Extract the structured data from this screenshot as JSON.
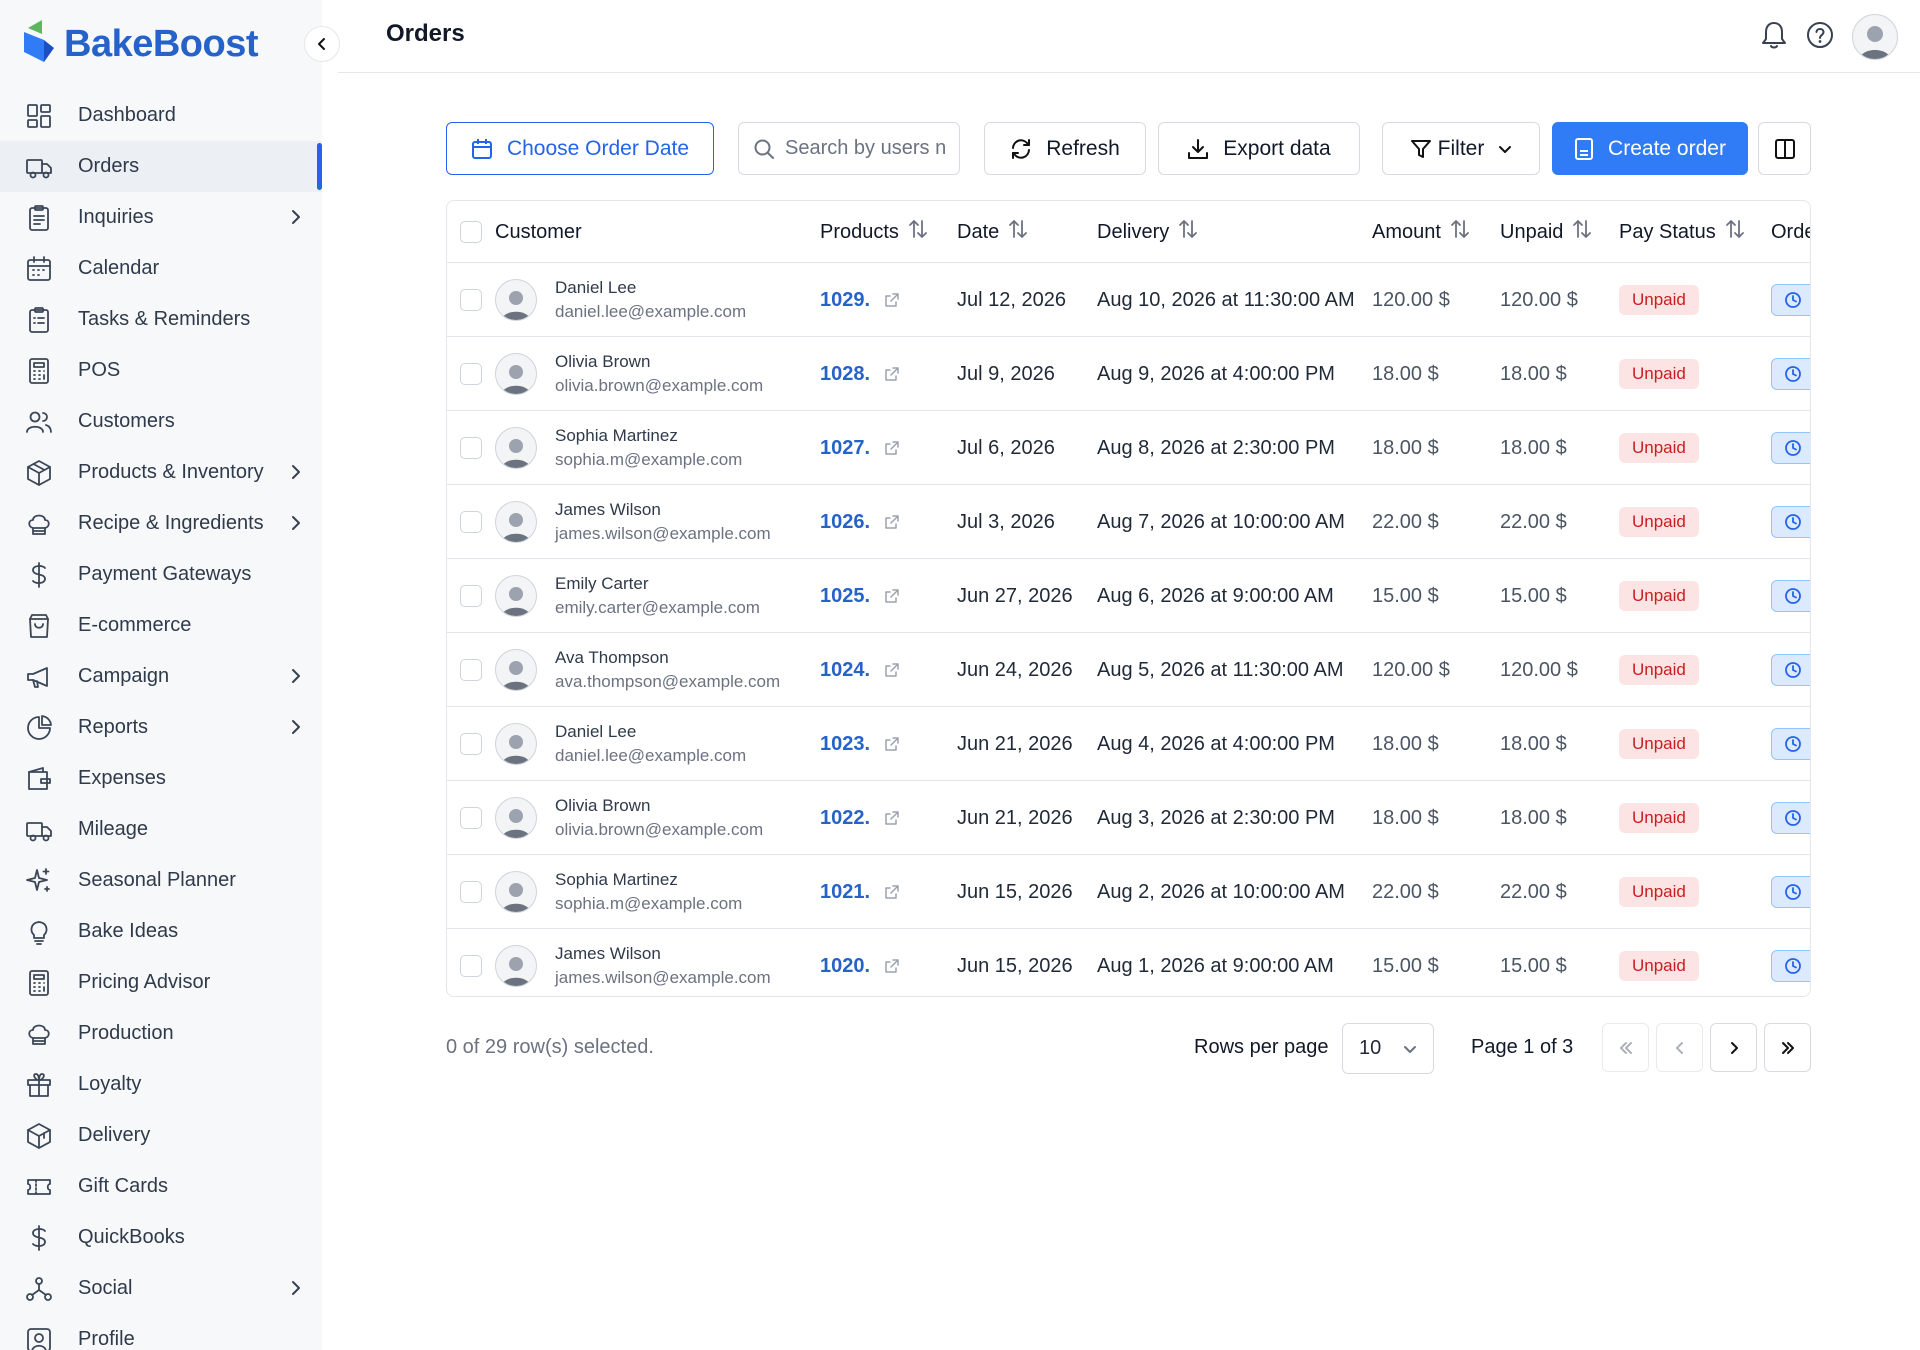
{
  "brand": {
    "name": "BakeBoost"
  },
  "header": {
    "title": "Orders"
  },
  "sidebar": {
    "items": [
      {
        "label": "Dashboard",
        "icon": "dashboard-icon",
        "active": false,
        "has_submenu": false
      },
      {
        "label": "Orders",
        "icon": "truck-icon",
        "active": true,
        "has_submenu": false
      },
      {
        "label": "Inquiries",
        "icon": "clipboard-icon",
        "active": false,
        "has_submenu": true
      },
      {
        "label": "Calendar",
        "icon": "calendar-icon",
        "active": false,
        "has_submenu": false
      },
      {
        "label": "Tasks & Reminders",
        "icon": "clipboard-list-icon",
        "active": false,
        "has_submenu": false
      },
      {
        "label": "POS",
        "icon": "calculator-icon",
        "active": false,
        "has_submenu": false
      },
      {
        "label": "Customers",
        "icon": "users-icon",
        "active": false,
        "has_submenu": false
      },
      {
        "label": "Products & Inventory",
        "icon": "box-icon",
        "active": false,
        "has_submenu": true
      },
      {
        "label": "Recipe & Ingredients",
        "icon": "chef-hat-icon",
        "active": false,
        "has_submenu": true
      },
      {
        "label": "Payment Gateways",
        "icon": "dollar-icon",
        "active": false,
        "has_submenu": false
      },
      {
        "label": "E-commerce",
        "icon": "shopping-bag-icon",
        "active": false,
        "has_submenu": false
      },
      {
        "label": "Campaign",
        "icon": "megaphone-icon",
        "active": false,
        "has_submenu": true
      },
      {
        "label": "Reports",
        "icon": "pie-chart-icon",
        "active": false,
        "has_submenu": true
      },
      {
        "label": "Expenses",
        "icon": "wallet-icon",
        "active": false,
        "has_submenu": false
      },
      {
        "label": "Mileage",
        "icon": "truck-icon",
        "active": false,
        "has_submenu": false
      },
      {
        "label": "Seasonal Planner",
        "icon": "sparkles-icon",
        "active": false,
        "has_submenu": false
      },
      {
        "label": "Bake Ideas",
        "icon": "lightbulb-icon",
        "active": false,
        "has_submenu": false
      },
      {
        "label": "Pricing Advisor",
        "icon": "calculator-icon",
        "active": false,
        "has_submenu": false
      },
      {
        "label": "Production",
        "icon": "chef-hat-icon",
        "active": false,
        "has_submenu": false
      },
      {
        "label": "Loyalty",
        "icon": "gift-icon",
        "active": false,
        "has_submenu": false
      },
      {
        "label": "Delivery",
        "icon": "package-icon",
        "active": false,
        "has_submenu": false
      },
      {
        "label": "Gift Cards",
        "icon": "ticket-icon",
        "active": false,
        "has_submenu": false
      },
      {
        "label": "QuickBooks",
        "icon": "dollar-icon",
        "active": false,
        "has_submenu": false
      },
      {
        "label": "Social",
        "icon": "network-icon",
        "active": false,
        "has_submenu": true
      },
      {
        "label": "Profile",
        "icon": "user-square-icon",
        "active": false,
        "has_submenu": false
      }
    ]
  },
  "toolbar": {
    "date_label": "Choose Order Date",
    "search_placeholder": "Search by users name",
    "refresh_label": "Refresh",
    "export_label": "Export data",
    "filter_label": "Filter",
    "create_label": "Create order"
  },
  "table": {
    "columns": {
      "customer": "Customer",
      "products": "Products",
      "date": "Date",
      "delivery": "Delivery",
      "amount": "Amount",
      "unpaid": "Unpaid",
      "pay_status": "Pay Status",
      "order_status": "Orde"
    },
    "rows": [
      {
        "name": "Daniel Lee",
        "email": "daniel.lee@example.com",
        "product": "1029.",
        "date": "Jul 12, 2026",
        "delivery": "Aug 10, 2026 at 11:30:00 AM",
        "amount": "120.00 $",
        "unpaid": "120.00 $",
        "pay_status": "Unpaid"
      },
      {
        "name": "Olivia Brown",
        "email": "olivia.brown@example.com",
        "product": "1028.",
        "date": "Jul 9, 2026",
        "delivery": "Aug 9, 2026 at 4:00:00 PM",
        "amount": "18.00 $",
        "unpaid": "18.00 $",
        "pay_status": "Unpaid"
      },
      {
        "name": "Sophia Martinez",
        "email": "sophia.m@example.com",
        "product": "1027.",
        "date": "Jul 6, 2026",
        "delivery": "Aug 8, 2026 at 2:30:00 PM",
        "amount": "18.00 $",
        "unpaid": "18.00 $",
        "pay_status": "Unpaid"
      },
      {
        "name": "James Wilson",
        "email": "james.wilson@example.com",
        "product": "1026.",
        "date": "Jul 3, 2026",
        "delivery": "Aug 7, 2026 at 10:00:00 AM",
        "amount": "22.00 $",
        "unpaid": "22.00 $",
        "pay_status": "Unpaid"
      },
      {
        "name": "Emily Carter",
        "email": "emily.carter@example.com",
        "product": "1025.",
        "date": "Jun 27, 2026",
        "delivery": "Aug 6, 2026 at 9:00:00 AM",
        "amount": "15.00 $",
        "unpaid": "15.00 $",
        "pay_status": "Unpaid"
      },
      {
        "name": "Ava Thompson",
        "email": "ava.thompson@example.com",
        "product": "1024.",
        "date": "Jun 24, 2026",
        "delivery": "Aug 5, 2026 at 11:30:00 AM",
        "amount": "120.00 $",
        "unpaid": "120.00 $",
        "pay_status": "Unpaid"
      },
      {
        "name": "Daniel Lee",
        "email": "daniel.lee@example.com",
        "product": "1023.",
        "date": "Jun 21, 2026",
        "delivery": "Aug 4, 2026 at 4:00:00 PM",
        "amount": "18.00 $",
        "unpaid": "18.00 $",
        "pay_status": "Unpaid"
      },
      {
        "name": "Olivia Brown",
        "email": "olivia.brown@example.com",
        "product": "1022.",
        "date": "Jun 21, 2026",
        "delivery": "Aug 3, 2026 at 2:30:00 PM",
        "amount": "18.00 $",
        "unpaid": "18.00 $",
        "pay_status": "Unpaid"
      },
      {
        "name": "Sophia Martinez",
        "email": "sophia.m@example.com",
        "product": "1021.",
        "date": "Jun 15, 2026",
        "delivery": "Aug 2, 2026 at 10:00:00 AM",
        "amount": "22.00 $",
        "unpaid": "22.00 $",
        "pay_status": "Unpaid"
      },
      {
        "name": "James Wilson",
        "email": "james.wilson@example.com",
        "product": "1020.",
        "date": "Jun 15, 2026",
        "delivery": "Aug 1, 2026 at 9:00:00 AM",
        "amount": "15.00 $",
        "unpaid": "15.00 $",
        "pay_status": "Unpaid"
      }
    ]
  },
  "footer": {
    "selection": "0 of 29 row(s) selected.",
    "rows_per_page_label": "Rows per page",
    "rows_per_page_value": "10",
    "page_label": "Page 1 of 3"
  },
  "colors": {
    "accent": "#2563eb",
    "primary_button": "#2f7cf6",
    "brand_blue": "#2563c9",
    "logo_green": "#5cb85c",
    "unpaid_bg": "#fde4e4",
    "unpaid_text": "#c81e1e"
  }
}
